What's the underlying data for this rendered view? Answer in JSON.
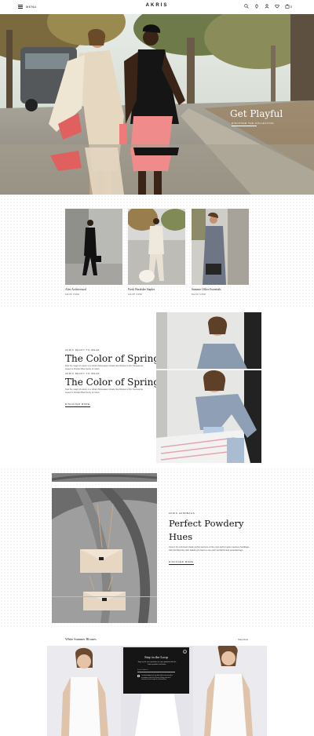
{
  "header": {
    "menu_label": "MENU",
    "logo": "AKRIS",
    "icons": [
      "search-icon",
      "location-icon",
      "account-icon",
      "wishlist-icon",
      "bag-icon"
    ],
    "bag_count": "0"
  },
  "hero": {
    "title": "Get Playful",
    "subtitle": "DISCOVER THE COLLECTION"
  },
  "products": [
    {
      "title": "Alter Architectural",
      "link": "SHOP NOW"
    },
    {
      "title": "Fresh Wardrobe Staples",
      "link": "SHOP NOW"
    },
    {
      "title": "Summer Office Essentials",
      "link": "SHOP NOW"
    }
  ],
  "spring": {
    "eyebrow": "AKRIS READY-TO-WEAR",
    "title": "The Color of Spring",
    "text": "Feel the magic of nature in a vibrant Mid-season shade that blossoms this Trentavecia season's Powder Blue family of colors.",
    "eyebrow2": "AKRIS READY-TO-WEAR",
    "title2": "The Color of Spring",
    "text2": "Feel the magic of nature in a vibrant Mid-season shade that blossoms this Trentavecia season's Powder Blue family of colors.",
    "cta": "DISCOVER MORE"
  },
  "powdery": {
    "eyebrow": "AKRIS HANDBAGS",
    "title_line1": "Perfect Powdery",
    "title_line2": "Hues",
    "text": "Give in the soft-hued shade perfect and one of the most perfect warm seasons handbags. with this Beat the color palette you have to use color wonderful and essential bags.",
    "cta": "DISCOVER MORE"
  },
  "blouses": {
    "title": "White Summer Blouses",
    "shop_now": "Shop Now"
  },
  "popup": {
    "title": "Stay in the Loop",
    "text": "Sign up for our newsletter to stay updated with the latest product and news.",
    "input_placeholder": "Email address",
    "consent": "I acknowledge that my data will be processed in accordance with the Privacy Policy and that I consent to the receipt of e-newsletters.",
    "close": "×"
  },
  "colors": {
    "brand_text": "#111111",
    "popup_bg": "#151515",
    "dot_pattern": "#d8d8d8",
    "hero_pink": "#f08b8b"
  }
}
